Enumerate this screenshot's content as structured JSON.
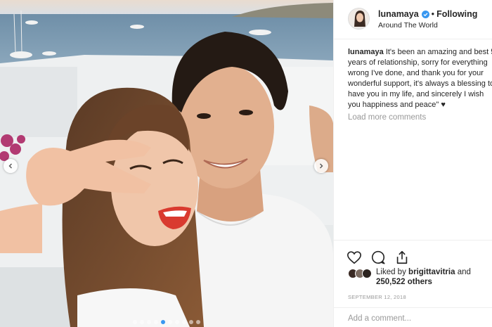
{
  "post": {
    "username": "lunamaya",
    "separator": "•",
    "follow_label": "Following",
    "location": "Around The World",
    "caption_lines": [
      "It's been an amazing and best 5",
      "years of relationship, sorry for everything",
      "wrong I've done, and thank you for your",
      "wonderful support, it's always a blessing to",
      "have you in my life, and sincerely I wish",
      "you happiness and peace\" ♥"
    ],
    "load_more_label": "Load more comments",
    "liked_by_prefix": "Liked by",
    "liked_by_user": "brigittavitria",
    "liked_by_and": "and",
    "likes_count": "250,522 others",
    "date": "September 12, 2018",
    "comment_placeholder": "Add a comment..."
  },
  "icons": {
    "verified": "verified-badge-icon",
    "like": "heart-icon",
    "comment": "comment-icon",
    "share": "share-icon",
    "prev": "chevron-left-icon",
    "next": "chevron-right-icon"
  },
  "colors": {
    "accent": "#3897f0",
    "text": "#262626",
    "muted": "#999999",
    "border": "#efefef"
  }
}
